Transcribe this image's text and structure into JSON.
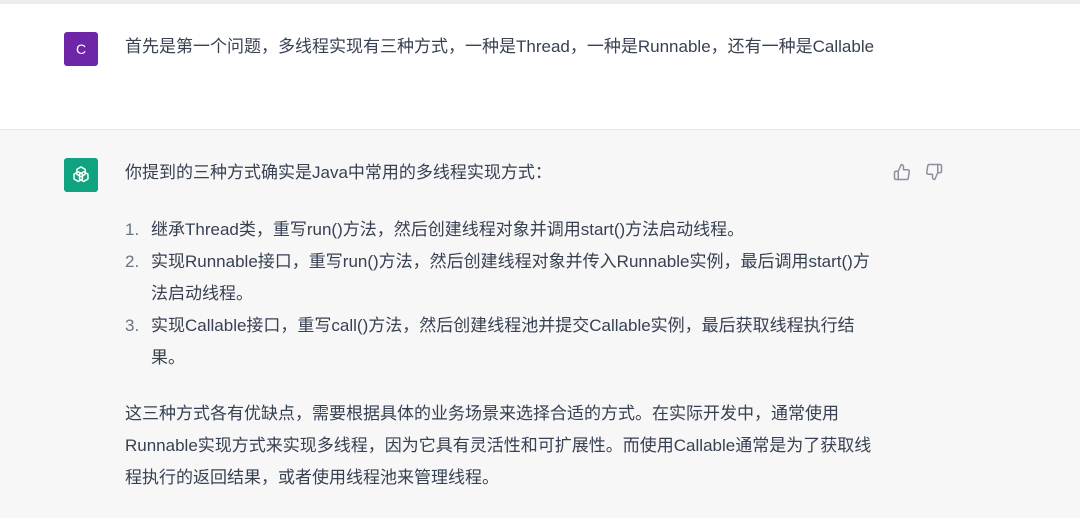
{
  "user_message": {
    "avatar_letter": "C",
    "text": "首先是第一个问题，多线程实现有三种方式，一种是Thread，一种是Runnable，还有一种是Callable"
  },
  "assistant_message": {
    "intro": "你提到的三种方式确实是Java中常用的多线程实现方式：",
    "list": [
      {
        "num": "1.",
        "text": "继承Thread类，重写run()方法，然后创建线程对象并调用start()方法启动线程。"
      },
      {
        "num": "2.",
        "text": "实现Runnable接口，重写run()方法，然后创建线程对象并传入Runnable实例，最后调用start()方法启动线程。"
      },
      {
        "num": "3.",
        "text": "实现Callable接口，重写call()方法，然后创建线程池并提交Callable实例，最后获取线程执行结果。"
      }
    ],
    "conclusion": "这三种方式各有优缺点，需要根据具体的业务场景来选择合适的方式。在实际开发中，通常使用Runnable实现方式来实现多线程，因为它具有灵活性和可扩展性。而使用Callable通常是为了获取线程执行的返回结果，或者使用线程池来管理线程。"
  },
  "icons": {
    "assistant_avatar": "openai-logo-icon",
    "feedback_up": "thumbs-up-icon",
    "feedback_down": "thumbs-down-icon"
  },
  "colors": {
    "user_avatar_bg": "#6d26a8",
    "assistant_avatar_bg": "#10a37f",
    "assistant_block_bg": "#f7f7f8"
  }
}
